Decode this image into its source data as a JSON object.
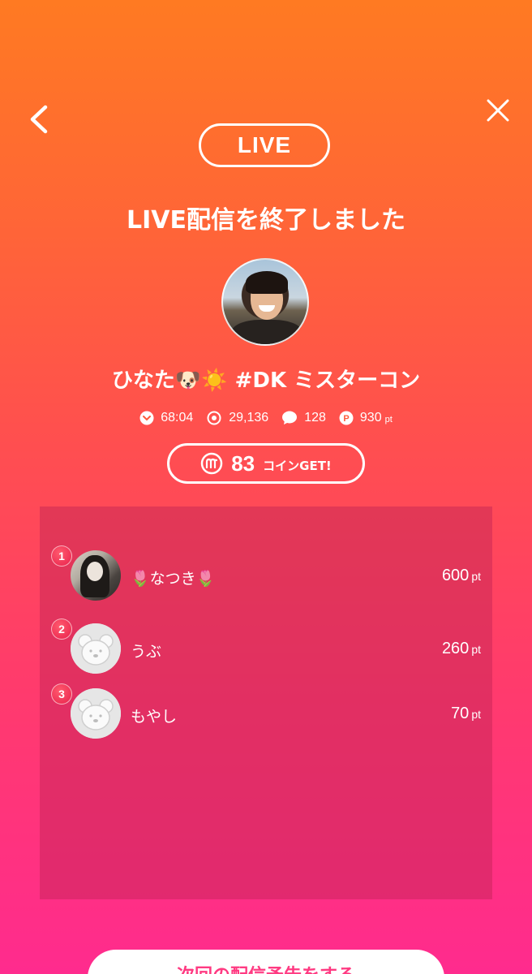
{
  "header": {
    "back_icon": "chevron-left-icon",
    "close_icon": "close-icon",
    "live_label": "LIVE",
    "title": "LIVE配信を終了しました"
  },
  "streamer": {
    "name": "ひなた🐶☀️ #DK ミスターコン"
  },
  "stats": {
    "duration": "68:04",
    "viewers": "29,136",
    "comments": "128",
    "points": "930",
    "points_unit": "pt"
  },
  "coin": {
    "amount": "83",
    "label": "コインGET!"
  },
  "ranking": [
    {
      "rank": "1",
      "name": "🌷なつき🌷",
      "points": "600",
      "unit": "pt"
    },
    {
      "rank": "2",
      "name": "うぶ",
      "points": "260",
      "unit": "pt"
    },
    {
      "rank": "3",
      "name": "もやし",
      "points": "70",
      "unit": "pt"
    }
  ],
  "footer": {
    "next_button": "次回の配信予告をする"
  },
  "colors": {
    "gradient_top": "#ff7a22",
    "gradient_bottom": "#ff2b8e",
    "accent_pink": "#ff3a82"
  }
}
